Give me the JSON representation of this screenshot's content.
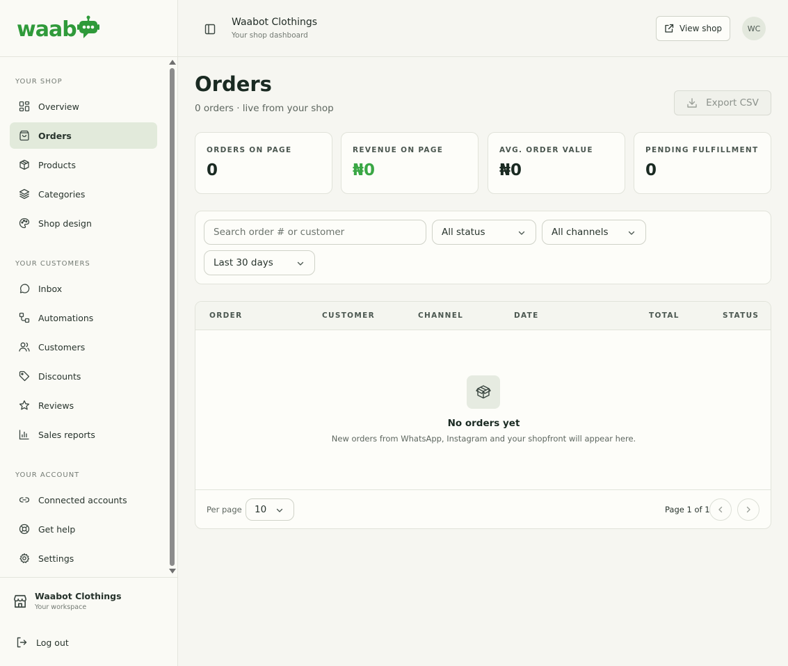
{
  "brand": {
    "logo_text": "waab",
    "accent": "#2f9a3a"
  },
  "sidebar": {
    "sections": [
      {
        "label": "YOUR SHOP",
        "items": [
          {
            "label": "Overview",
            "icon": "grid-icon"
          },
          {
            "label": "Orders",
            "icon": "shopping-bag-icon",
            "active": true
          },
          {
            "label": "Products",
            "icon": "package-icon"
          },
          {
            "label": "Categories",
            "icon": "layers-icon"
          },
          {
            "label": "Shop design",
            "icon": "palette-icon"
          }
        ]
      },
      {
        "label": "YOUR CUSTOMERS",
        "items": [
          {
            "label": "Inbox",
            "icon": "message-circle-icon"
          },
          {
            "label": "Automations",
            "icon": "workflow-icon"
          },
          {
            "label": "Customers",
            "icon": "users-icon"
          },
          {
            "label": "Discounts",
            "icon": "tag-icon"
          },
          {
            "label": "Reviews",
            "icon": "star-icon"
          },
          {
            "label": "Sales reports",
            "icon": "bar-chart-icon"
          }
        ]
      },
      {
        "label": "YOUR ACCOUNT",
        "items": [
          {
            "label": "Connected accounts",
            "icon": "link-icon"
          },
          {
            "label": "Get help",
            "icon": "lifebuoy-icon"
          },
          {
            "label": "Settings",
            "icon": "gear-icon"
          }
        ]
      }
    ],
    "workspace": {
      "name": "Waabot Clothings",
      "sub": "Your workspace"
    },
    "logout": "Log out"
  },
  "topbar": {
    "shop_name": "Waabot Clothings",
    "shop_sub": "Your shop dashboard",
    "view_shop": "View shop",
    "avatar_initials": "WC"
  },
  "page": {
    "title": "Orders",
    "subtitle": "0 orders · live from your shop",
    "export_label": "Export CSV"
  },
  "stats": [
    {
      "label": "ORDERS ON PAGE",
      "value": "0"
    },
    {
      "label": "REVENUE ON PAGE",
      "value": "₦0",
      "color": "#3aa745"
    },
    {
      "label": "AVG. ORDER VALUE",
      "value": "₦0"
    },
    {
      "label": "PENDING FULFILLMENT",
      "value": "0"
    }
  ],
  "filters": {
    "search_placeholder": "Search order # or customer",
    "status": "All status",
    "channels": "All channels",
    "range": "Last 30 days"
  },
  "table": {
    "columns": [
      "ORDER",
      "CUSTOMER",
      "CHANNEL",
      "DATE",
      "TOTAL",
      "STATUS"
    ],
    "empty_title": "No orders yet",
    "empty_sub": "New orders from WhatsApp, Instagram and your shopfront will appear here.",
    "per_page_label": "Per page",
    "per_page_value": "10",
    "page_info": "Page 1 of 1"
  }
}
